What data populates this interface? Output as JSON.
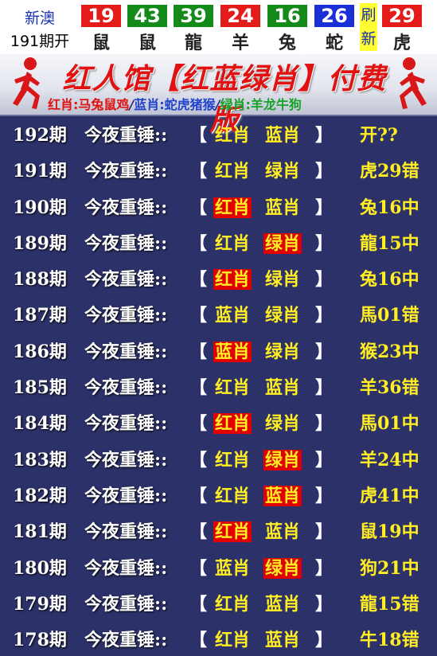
{
  "top": {
    "region": "新澳",
    "period": "191期开",
    "balls": [
      {
        "num": "19",
        "zodiac": "鼠",
        "color": "#e41b1b"
      },
      {
        "num": "43",
        "zodiac": "鼠",
        "color": "#138a1a"
      },
      {
        "num": "39",
        "zodiac": "龍",
        "color": "#138a1a"
      },
      {
        "num": "24",
        "zodiac": "羊",
        "color": "#e41b1b"
      },
      {
        "num": "16",
        "zodiac": "兔",
        "color": "#138a1a"
      },
      {
        "num": "26",
        "zodiac": "蛇",
        "color": "#1a2fd6"
      }
    ],
    "refresh": [
      "刷",
      "新"
    ],
    "special": {
      "num": "29",
      "zodiac": "虎",
      "color": "#e41b1b"
    }
  },
  "banner": {
    "title": "红人馆【红蓝绿肖】付费版",
    "red_label": "红肖:马兔鼠鸡",
    "blue_label": "蓝肖:蛇虎猪猴",
    "green_label": "绿肖:羊龙牛狗",
    "slash": "/"
  },
  "common": {
    "phrase": "今夜重锤::",
    "open_bracket": "【",
    "close_bracket": "】"
  },
  "rows": [
    {
      "period": "192期",
      "t1": "红肖",
      "t2": "蓝肖",
      "hl": 0,
      "result": "开??"
    },
    {
      "period": "191期",
      "t1": "红肖",
      "t2": "绿肖",
      "hl": 0,
      "result": "虎29错"
    },
    {
      "period": "190期",
      "t1": "红肖",
      "t2": "蓝肖",
      "hl": 1,
      "result": "兔16中"
    },
    {
      "period": "189期",
      "t1": "红肖",
      "t2": "绿肖",
      "hl": 2,
      "result": "龍15中"
    },
    {
      "period": "188期",
      "t1": "红肖",
      "t2": "绿肖",
      "hl": 1,
      "result": "兔16中"
    },
    {
      "period": "187期",
      "t1": "蓝肖",
      "t2": "绿肖",
      "hl": 0,
      "result": "馬01错"
    },
    {
      "period": "186期",
      "t1": "蓝肖",
      "t2": "绿肖",
      "hl": 1,
      "result": "猴23中"
    },
    {
      "period": "185期",
      "t1": "红肖",
      "t2": "蓝肖",
      "hl": 0,
      "result": "羊36错"
    },
    {
      "period": "184期",
      "t1": "红肖",
      "t2": "绿肖",
      "hl": 1,
      "result": "馬01中"
    },
    {
      "period": "183期",
      "t1": "红肖",
      "t2": "绿肖",
      "hl": 2,
      "result": "羊24中"
    },
    {
      "period": "182期",
      "t1": "红肖",
      "t2": "蓝肖",
      "hl": 2,
      "result": "虎41中"
    },
    {
      "period": "181期",
      "t1": "红肖",
      "t2": "蓝肖",
      "hl": 1,
      "result": "鼠19中"
    },
    {
      "period": "180期",
      "t1": "蓝肖",
      "t2": "绿肖",
      "hl": 2,
      "result": "狗21中"
    },
    {
      "period": "179期",
      "t1": "红肖",
      "t2": "蓝肖",
      "hl": 0,
      "result": "龍15错"
    },
    {
      "period": "178期",
      "t1": "红肖",
      "t2": "蓝肖",
      "hl": 0,
      "result": "牛18错"
    }
  ]
}
